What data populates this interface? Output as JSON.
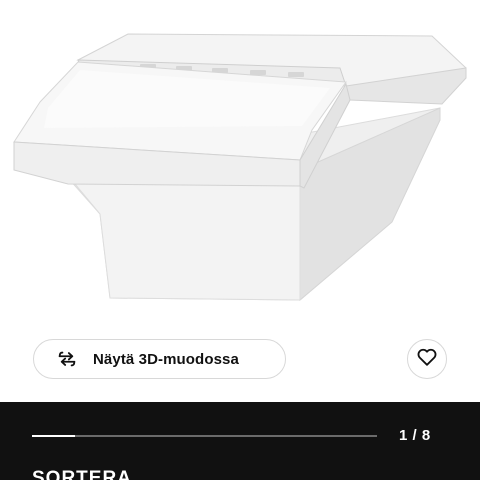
{
  "product_image": {
    "alt": "Valkoinen jätelajittelulaatikko kannella"
  },
  "view_3d": {
    "label": "Näytä 3D-muodossa",
    "icon": "rotate-arrows-icon"
  },
  "favourite": {
    "icon": "heart-outline-icon"
  },
  "gallery": {
    "page_indicator": "1 / 8",
    "current": 1,
    "total": 8
  },
  "product": {
    "name": "SORTERA"
  },
  "colors": {
    "panel_background": "#111111",
    "progress_track": "#6b6b6b",
    "progress_fill": "#ffffff"
  }
}
